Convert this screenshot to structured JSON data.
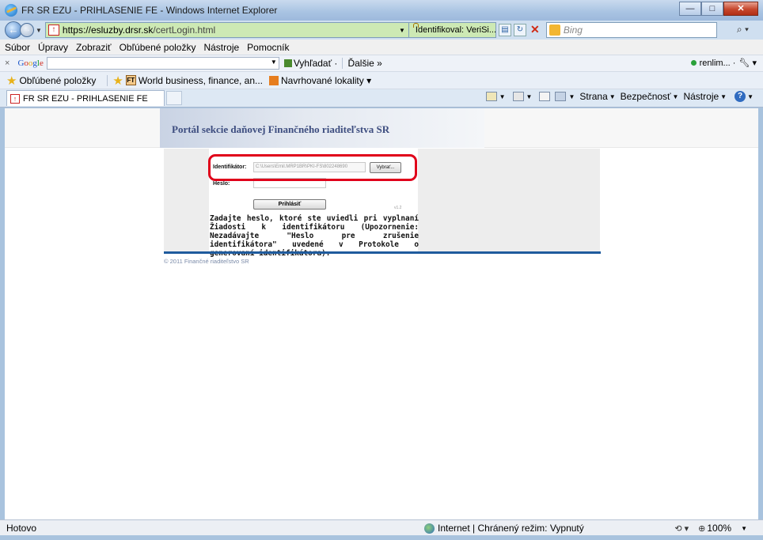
{
  "window": {
    "title": "FR SR EZU - PRIHLASENIE FE - Windows Internet Explorer",
    "minimize_label": "—",
    "maximize_label": "□",
    "close_label": "✕"
  },
  "address": {
    "url_host": "https://esluzby.drsr.sk",
    "url_path": "/certLogin.html",
    "cert_label": "Identifikoval: VeriSi...",
    "search_placeholder": "Bing"
  },
  "menu": {
    "items": [
      "Súbor",
      "Úpravy",
      "Zobraziť",
      "Obľúbené položky",
      "Nástroje",
      "Pomocník"
    ]
  },
  "google_toolbar": {
    "close": "×",
    "search_label": "Vyhľadať ·",
    "more_label": "Ďalšie »",
    "user_label": "renlim... ·"
  },
  "favorites": {
    "label": "Obľúbené položky",
    "item1": "World business, finance, an...",
    "item2": "Navrhované lokality ▾"
  },
  "tabs": {
    "active_tab": "FR SR EZU - PRIHLASENIE FE"
  },
  "commandbar": {
    "page_label": "Strana",
    "safety_label": "Bezpečnosť",
    "tools_label": "Nástroje"
  },
  "page": {
    "banner_title": "Portál sekcie daňovej Finančného riaditeľstva SR",
    "identifier_label": "Identifikátor:",
    "identifier_value": "C:\\Users\\Emil.MRP1BR\\PKI-FS\\802248690",
    "browse_label": "Vybrať...",
    "password_label": "Heslo:",
    "login_label": "Prihlásiť",
    "version": "v1.2",
    "info_text": "Zadajte heslo, ktoré ste uviedli pri vyplnaní Žiadosti k identifikátoru (Upozornenie: Nezadávajte \"Heslo pre zrušenie identifikátora\" uvedené v Protokole o generovaní identifikátora).",
    "copyright": "© 2011 Finančné riaditeľstvo SR"
  },
  "status": {
    "left": "Hotovo",
    "zone": "Internet | Chránený režim: Vypnutý",
    "zoom": "100%"
  },
  "colors": {
    "highlight": "#e0001a",
    "rule": "#1f5b9d",
    "banner_text": "#3d4d7f"
  }
}
